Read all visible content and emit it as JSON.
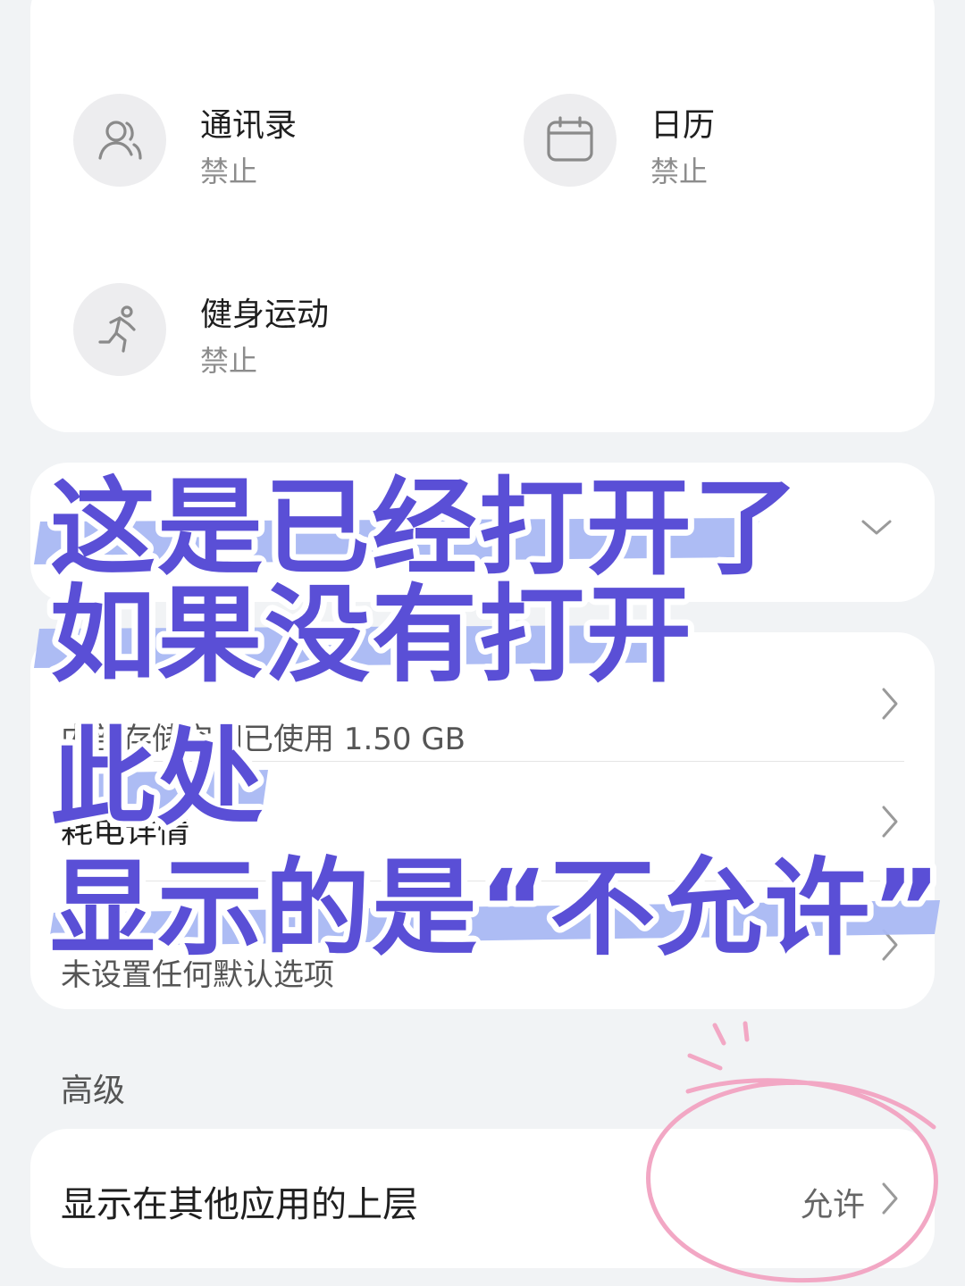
{
  "permissions": [
    {
      "title": "通讯录",
      "status": "禁止",
      "icon": "contacts-icon"
    },
    {
      "title": "日历",
      "status": "禁止",
      "icon": "calendar-icon"
    },
    {
      "title": "健身运动",
      "status": "禁止",
      "icon": "fitness-icon"
    }
  ],
  "info_rows": {
    "storage": "内部存储空间已使用 1.50 GB",
    "power_label": "耗电详情",
    "defaults_value": "未设置任何默认选项"
  },
  "advanced": {
    "section_title": "高级",
    "overlay_label": "显示在其他应用的上层",
    "overlay_value": "允许"
  },
  "annotation": {
    "lines": [
      "这是已经打开了",
      "如果没有打开",
      "此处",
      "显示的是“不允许”"
    ],
    "text_color": "#5a4fd6",
    "highlight_color": "#a9b8f3",
    "circle_color": "#f2a7c4"
  }
}
